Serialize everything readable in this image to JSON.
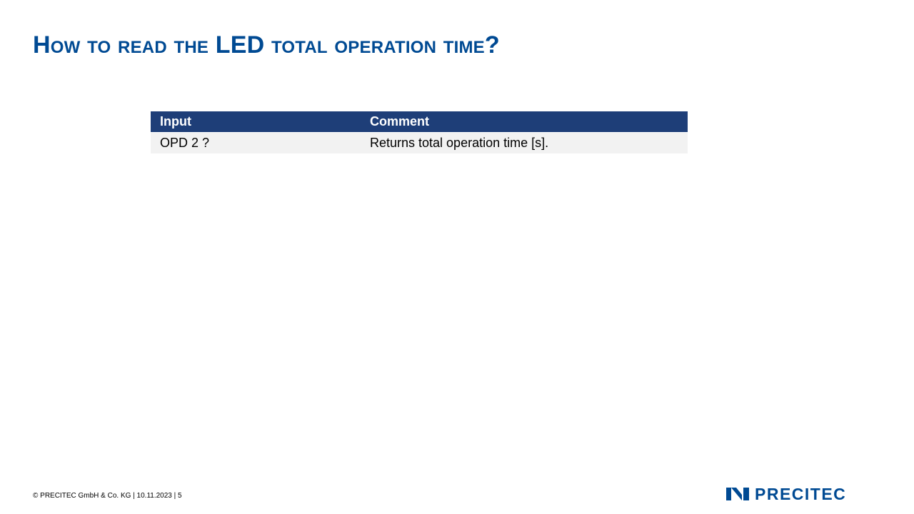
{
  "slide": {
    "title": "How to read the LED total operation time?"
  },
  "table": {
    "headers": {
      "input": "Input",
      "comment": "Comment"
    },
    "rows": [
      {
        "input": "OPD 2 ?",
        "comment": "Returns total operation time [s]."
      }
    ]
  },
  "footer": {
    "text": "© PRECITEC  GmbH  & Co. KG | 10.11.2023 | 5"
  },
  "logo": {
    "wordmark": "PRECITEC",
    "color": "#004a93"
  },
  "colors": {
    "title": "#004a93",
    "table_header_bg": "#1e3e78",
    "table_row_bg": "#f2f2f2"
  }
}
